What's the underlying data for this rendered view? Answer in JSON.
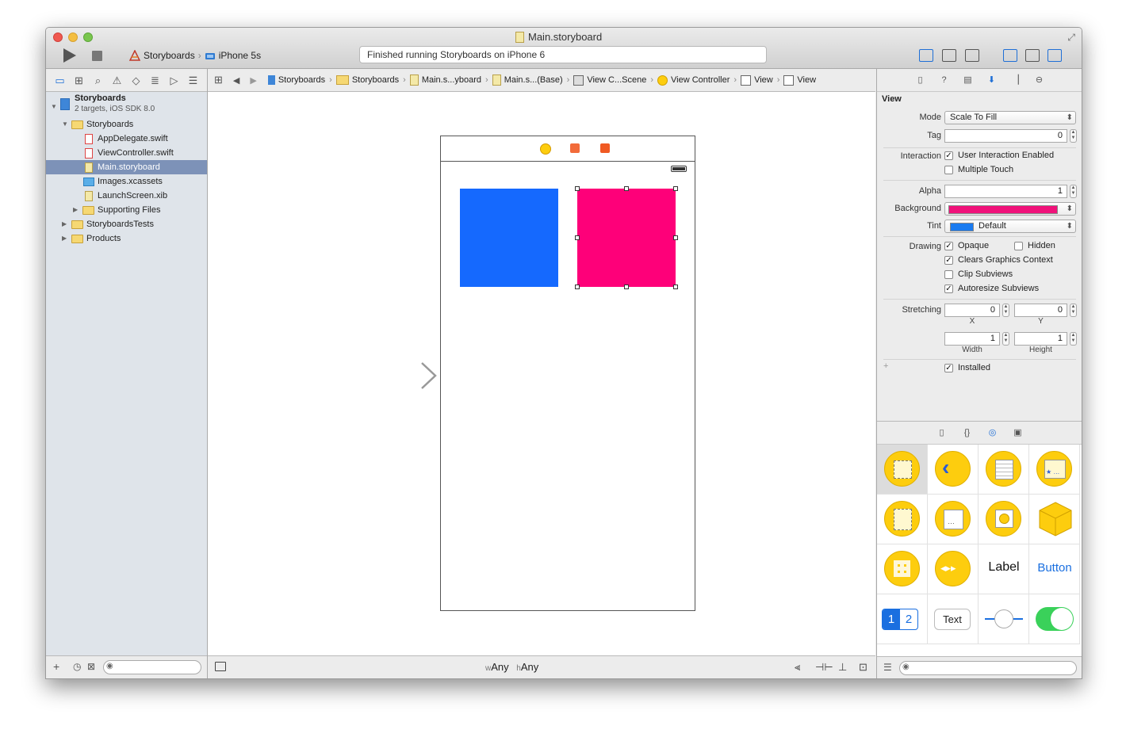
{
  "window": {
    "title": "Main.storyboard"
  },
  "toolbar": {
    "scheme": "Storyboards",
    "device": "iPhone 5s",
    "status": "Finished running Storyboards on iPhone 6"
  },
  "navigator": {
    "project": {
      "name": "Storyboards",
      "subtitle": "2 targets, iOS SDK 8.0"
    },
    "items": [
      {
        "label": "Storyboards"
      },
      {
        "label": "AppDelegate.swift"
      },
      {
        "label": "ViewController.swift"
      },
      {
        "label": "Main.storyboard"
      },
      {
        "label": "Images.xcassets"
      },
      {
        "label": "LaunchScreen.xib"
      },
      {
        "label": "Supporting Files"
      },
      {
        "label": "StoryboardsTests"
      },
      {
        "label": "Products"
      }
    ]
  },
  "jumpbar": [
    "Storyboards",
    "Storyboards",
    "Main.s...yboard",
    "Main.s...(Base)",
    "View C...Scene",
    "View Controller",
    "View",
    "View"
  ],
  "canvas": {
    "size_class": {
      "w_prefix": "w",
      "w": "Any",
      "h_prefix": "h",
      "h": "Any"
    },
    "colors": {
      "blue_view": "#1569fe",
      "pink_view": "#fe0079"
    }
  },
  "inspector": {
    "section": "View",
    "mode_label": "Mode",
    "mode_value": "Scale To Fill",
    "tag_label": "Tag",
    "tag_value": "0",
    "interaction_label": "Interaction",
    "user_interaction": "User Interaction Enabled",
    "multiple_touch": "Multiple Touch",
    "alpha_label": "Alpha",
    "alpha_value": "1",
    "background_label": "Background",
    "background_color": "#f0127a",
    "tint_label": "Tint",
    "tint_value": "Default",
    "tint_color": "#1a7bf0",
    "drawing_label": "Drawing",
    "opaque": "Opaque",
    "hidden": "Hidden",
    "clears": "Clears Graphics Context",
    "clip": "Clip Subviews",
    "autoresize": "Autoresize Subviews",
    "stretching_label": "Stretching",
    "stretch_x": "0",
    "stretch_y": "0",
    "stretch_w": "1",
    "stretch_h": "1",
    "x_label": "X",
    "y_label": "Y",
    "width_label": "Width",
    "height_label": "Height",
    "installed": "Installed",
    "checks": {
      "user_interaction": true,
      "multiple_touch": false,
      "opaque": true,
      "hidden": false,
      "clears": true,
      "clip": false,
      "autoresize": true,
      "installed": true
    }
  },
  "library": {
    "label_text": "Label",
    "button_text": "Button",
    "seg_1": "1",
    "seg_2": "2",
    "textfield_text": "Text"
  }
}
